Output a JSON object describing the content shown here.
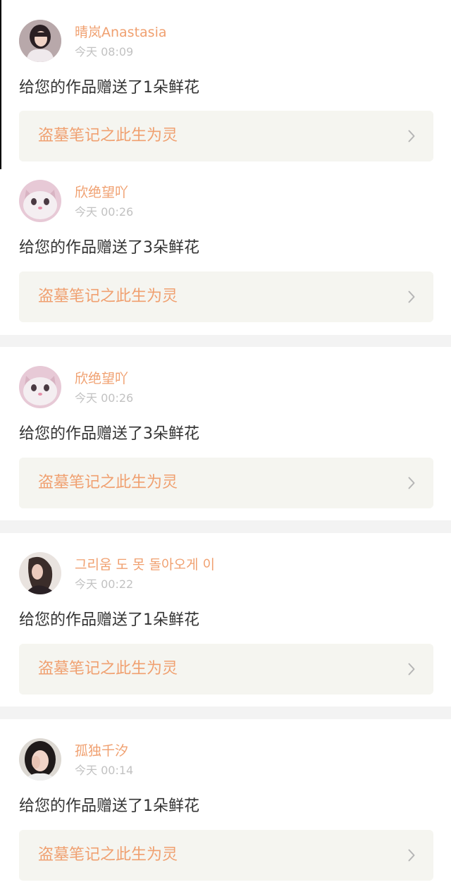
{
  "notifications": [
    {
      "username": "晴岚Anastasia",
      "time": "今天 08:09",
      "message": "给您的作品赠送了1朵鲜花",
      "work_title": "盗墓笔记之此生为灵",
      "avatar_icon": "girl-portrait-avatar"
    },
    {
      "username": "欣绝望吖",
      "time": "今天 00:26",
      "message": "给您的作品赠送了3朵鲜花",
      "work_title": "盗墓笔记之此生为灵",
      "avatar_icon": "cat-avatar"
    },
    {
      "username": "欣绝望吖",
      "time": "今天 00:26",
      "message": "给您的作品赠送了3朵鲜花",
      "work_title": "盗墓笔记之此生为灵",
      "avatar_icon": "cat-avatar"
    },
    {
      "username": "그리움 도 못 돌아오게 이",
      "time": "今天 00:22",
      "message": "给您的作品赠送了1朵鲜花",
      "work_title": "盗墓笔记之此生为灵",
      "avatar_icon": "girl-profile-avatar"
    },
    {
      "username": "孤独千汐",
      "time": "今天 00:14",
      "message": "给您的作品赠送了1朵鲜花",
      "work_title": "盗墓笔记之此生为灵",
      "avatar_icon": "girl-covering-face-avatar"
    }
  ],
  "colors": {
    "accent": "#f0a070",
    "timestamp": "#c2c2c2",
    "text": "#333333",
    "link_background": "#f5f5f0",
    "separator": "#f3f3f3"
  }
}
